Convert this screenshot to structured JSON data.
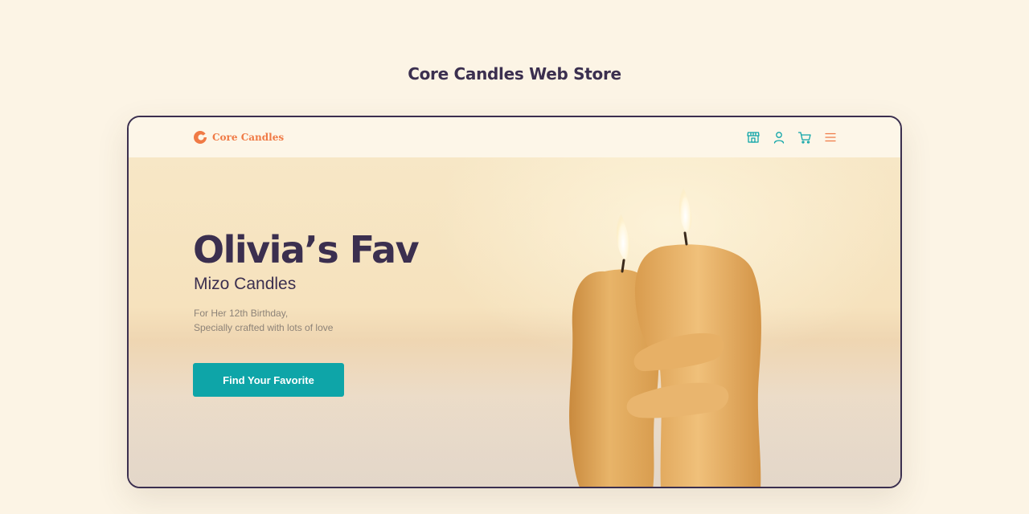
{
  "page": {
    "heading": "Core Candles Web Store"
  },
  "navbar": {
    "brand": "Core Candles",
    "icons": [
      "store-icon",
      "user-icon",
      "cart-icon",
      "menu-icon"
    ]
  },
  "hero": {
    "title": "Olivia’s Fav",
    "subtitle": "Mizo Candles",
    "description_lines": [
      "For Her 12th Birthday,",
      "Specially crafted with lots of love"
    ],
    "cta_label": "Find Your Favorite"
  },
  "colors": {
    "page_background": "#fcf4e5",
    "heading_text": "#3b2f4f",
    "brand_accent": "#f07a45",
    "primary_button": "#0ea5a8",
    "icon_teal": "#0ea5a8",
    "candle_wax": "#e2a95c"
  }
}
